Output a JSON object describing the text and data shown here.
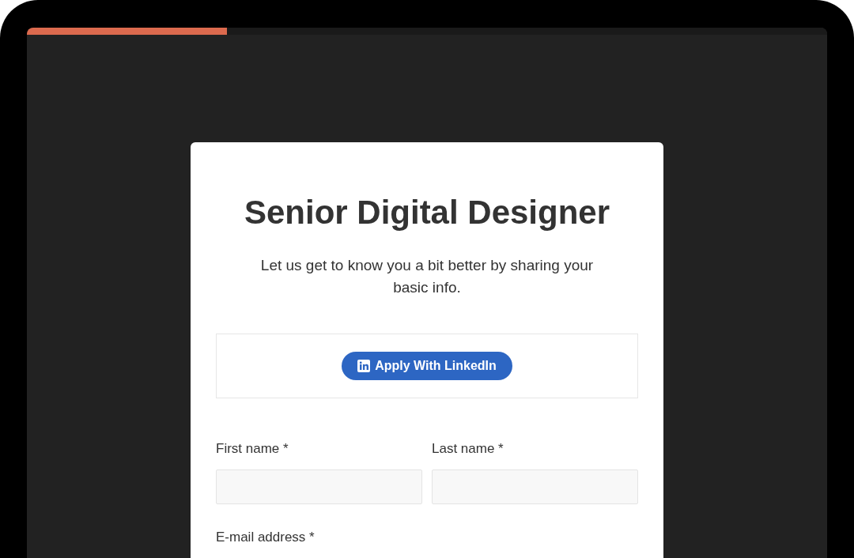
{
  "progress": {
    "level": 0.25
  },
  "form": {
    "title": "Senior Digital Designer",
    "intro": "Let us get to know you a bit better by sharing your basic info.",
    "linkedin_button": "Apply With LinkedIn",
    "name_fields": [
      {
        "label": "First name *"
      },
      {
        "label": "Last name *"
      }
    ],
    "email_field": {
      "label": "E-mail address *"
    }
  }
}
